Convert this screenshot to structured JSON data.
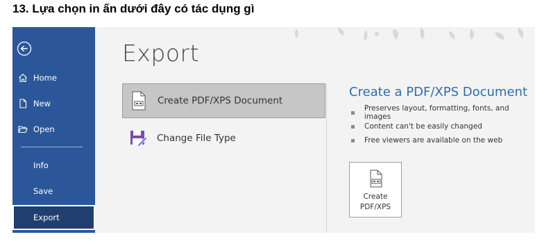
{
  "question": "13. Lựa chọn in ấn dưới đây có tác dụng gì",
  "nav": {
    "back_icon": "back-arrow-icon",
    "items": [
      {
        "label": "Home",
        "icon": "home-icon"
      },
      {
        "label": "New",
        "icon": "new-document-icon"
      },
      {
        "label": "Open",
        "icon": "open-folder-icon"
      },
      {
        "label": "Info"
      },
      {
        "label": "Save"
      },
      {
        "label": "Export",
        "active": true
      }
    ]
  },
  "main": {
    "title": "Export",
    "options": [
      {
        "label": "Create PDF/XPS Document",
        "icon": "pdf-document-icon",
        "selected": true
      },
      {
        "label": "Change File Type",
        "icon": "save-as-icon",
        "selected": false
      }
    ]
  },
  "detail": {
    "title": "Create a PDF/XPS Document",
    "bullets": [
      "Preserves layout, formatting, fonts, and images",
      "Content can't be easily changed",
      "Free viewers are available on the web"
    ],
    "button_label": "Create\nPDF/XPS",
    "button_icon": "pdf-document-icon"
  },
  "colors": {
    "nav_bg": "#2b579a",
    "nav_active_bg": "#1f3f6f",
    "detail_title": "#2e6ea8",
    "selected_bg": "#c6c6c6",
    "save_icon": "#7b4bb0"
  }
}
